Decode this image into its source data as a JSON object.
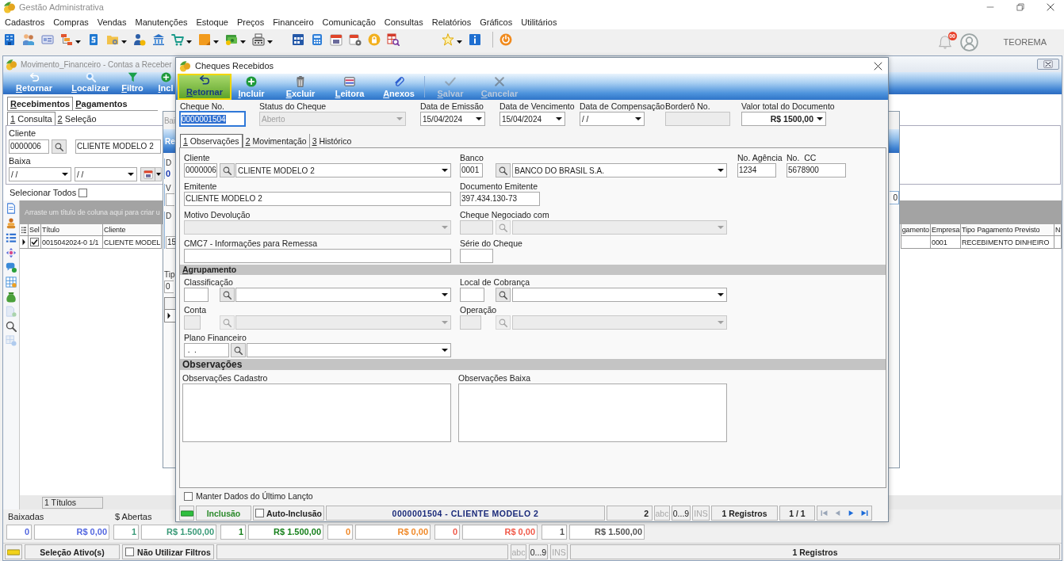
{
  "app_window": {
    "title": "Gestão Administrativa",
    "notification_count": "00",
    "user": "TEOREMA"
  },
  "menu_bar": [
    "Cadastros",
    "Compras",
    "Vendas",
    "Manutenções",
    "Estoque",
    "Preços",
    "Financeiro",
    "Comunicação",
    "Consultas",
    "Relatórios",
    "Gráficos",
    "Utilitários"
  ],
  "toolbar": [
    [
      {
        "dropdown": false
      },
      {
        "dropdown": false
      },
      {
        "dropdown": false
      },
      {
        "dropdown": true
      },
      {
        "dropdown": false
      },
      {
        "dropdown": true
      },
      {
        "dropdown": false
      },
      {
        "dropdown": false
      },
      {
        "dropdown": true
      },
      {
        "dropdown": true
      },
      {
        "dropdown": true
      },
      {
        "dropdown": true
      }
    ],
    [
      {
        "dropdown": false
      },
      {
        "dropdown": false
      },
      {
        "dropdown": false
      },
      {
        "dropdown": false
      },
      {
        "dropdown": false
      },
      {
        "dropdown": false
      }
    ],
    [
      {
        "dropdown": true
      },
      {
        "dropdown": false
      }
    ],
    [
      {
        "dropdown": false
      }
    ]
  ],
  "contas_window": {
    "title": "Movimento_Financeiro - Contas a Receber",
    "toolbar": [
      {
        "label": "Retornar"
      },
      {
        "label": "Localizar"
      },
      {
        "label": "Filtro"
      },
      {
        "label": "Incl"
      }
    ],
    "tabs": [
      {
        "label": "Recebimentos",
        "selected": true
      },
      {
        "label": "Pagamentos",
        "selected": false
      }
    ],
    "subtabs": [
      {
        "label": "1 Consulta",
        "selected": true
      },
      {
        "label": "2 Seleção",
        "selected": false
      }
    ],
    "cliente": {
      "label": "Cliente",
      "code": "0000006",
      "name": "CLIENTE MODELO 2"
    },
    "baixa": {
      "label": "Baixa",
      "from": "/ /",
      "to": "/ /"
    },
    "select_all": {
      "label": "Selecionar Todos",
      "checked": false
    },
    "side_tools": [
      {
        "disabled": false
      },
      {
        "disabled": false
      },
      {
        "disabled": false
      },
      {
        "disabled": false
      },
      {
        "disabled": false
      },
      {
        "disabled": false
      },
      {
        "disabled": false
      },
      {
        "disabled": true
      },
      {
        "disabled": false
      },
      {
        "disabled": true
      }
    ],
    "group_hint": "Arraste um título de coluna aqui para criar u",
    "grid": {
      "columns": [
        "Sel",
        "Título",
        "Cliente"
      ],
      "columns_right": [
        "gamento",
        "Empresa",
        "Tipo Pagamento Previsto",
        "N"
      ],
      "rows": [
        {
          "current": true,
          "checked": true,
          "titulo": "0015042024-0 1/1",
          "cliente": "CLIENTE MODEL",
          "empresa": "0001",
          "tipo_pagamento_previsto": "RECEBIMENTO DINHEIRO"
        }
      ]
    },
    "footer_count": "1 Títulos",
    "totals": {
      "baixadas_label": "Baixadas",
      "abertas_label": "$ Abertas",
      "items": [
        {
          "count": "0",
          "amount": "R$ 0,00",
          "color": "#5468e0"
        },
        {
          "count": "1",
          "amount": "R$ 1.500,00",
          "color": "#3a9a78"
        },
        {
          "count": "1",
          "amount": "R$ 1.500,00",
          "color": "#17801c"
        },
        {
          "count": "0",
          "amount": "R$ 0,00",
          "color": "#f08a2a"
        },
        {
          "count": "0",
          "amount": "R$ 0,00",
          "color": "#f05a4a"
        },
        {
          "count": "1",
          "amount": "R$ 1.500,00",
          "color": "#555555"
        }
      ]
    },
    "status_bar": {
      "selection": "Seleção Ativo(s)",
      "no_filters": {
        "label": "Não Utilizar Filtros",
        "checked": false
      },
      "indicators": [
        {
          "label": "abc",
          "active": false
        },
        {
          "label": "0...9",
          "active": true
        },
        {
          "label": "INS",
          "active": false
        }
      ],
      "records": "1 Registros"
    }
  },
  "middle_window": {
    "title": "Bai",
    "bar_label": "Re",
    "group_1_label": "D",
    "group_1_value": "0",
    "group_2_label": "V",
    "group_3_label": "D",
    "group_3_value": "15",
    "field_label": "Tip",
    "field_value": "0",
    "grid_rows": [
      {
        "current": true
      }
    ],
    "right_value": "0"
  },
  "cheque_dialog": {
    "title": "Cheques Recebidos",
    "toolbar": [
      {
        "label": "Retornar",
        "highlighted": true,
        "disabled": false
      },
      {
        "label": "Incluir",
        "highlighted": false,
        "disabled": false
      },
      {
        "label": "Excluir",
        "highlighted": false,
        "disabled": false
      },
      {
        "label": "Leitora",
        "highlighted": false,
        "disabled": false
      },
      {
        "label": "Anexos",
        "highlighted": false,
        "disabled": false
      },
      {
        "label": "Salvar",
        "highlighted": false,
        "disabled": true
      },
      {
        "label": "Cancelar",
        "highlighted": false,
        "disabled": true
      }
    ],
    "cheque_no": {
      "label": "Cheque No.",
      "value": "0000001504",
      "focused": true
    },
    "status": {
      "label": "Status do Cheque",
      "value": "Aberto",
      "disabled": true
    },
    "data_emissao": {
      "label": "Data de Emissão",
      "value": "15/04/2024"
    },
    "data_vencimento": {
      "label": "Data de Vencimento",
      "value": "15/04/2024"
    },
    "data_compensacao": {
      "label": "Data de Compensação",
      "value": "/ /"
    },
    "bordero": {
      "label": "Borderô No.",
      "disabled": true
    },
    "valor_total": {
      "label": "Valor total do Documento",
      "value": "R$ 1500,00"
    },
    "tabs": [
      {
        "label": "1 Observações",
        "selected": true
      },
      {
        "label": "2 Movimentação",
        "selected": false
      },
      {
        "label": "3 Histórico",
        "selected": false
      }
    ],
    "cliente": {
      "label": "Cliente",
      "code": "0000006",
      "name": "CLIENTE MODELO 2"
    },
    "banco": {
      "label": "Banco",
      "code": "0001",
      "name": "BANCO DO BRASIL S.A."
    },
    "agencia": {
      "label": "No. Agência",
      "value": "1234"
    },
    "conta_corrente": {
      "label": "No.  CC",
      "value": "5678900"
    },
    "emitente": {
      "label": "Emitente",
      "value": "CLIENTE MODELO 2"
    },
    "documento_emitente": {
      "label": "Documento Emitente",
      "value": "397.434.130-73"
    },
    "motivo_devolucao": {
      "label": "Motivo Devolução",
      "disabled": true
    },
    "cheque_negociado": {
      "label": "Cheque Negociado com",
      "disabled": true
    },
    "cmc7": {
      "label": "CMC7 - Informações para Remessa"
    },
    "serie": {
      "label": "Série do Cheque"
    },
    "agrupamento": "Agrupamento",
    "classificacao": {
      "label": "Classificação",
      "disabled": false
    },
    "local_cobranca": {
      "label": "Local de Cobrança",
      "disabled": false
    },
    "conta": {
      "label": "Conta",
      "disabled": true
    },
    "operacao": {
      "label": "Operação",
      "disabled": true
    },
    "plano_financeiro": {
      "label": "Plano Financeiro",
      "value": " .  ."
    },
    "observacoes": {
      "title": "Observações",
      "cadastro_label": "Observações Cadastro",
      "baixa_label": "Observações Baixa"
    },
    "manter_dados": {
      "label": "Manter Dados do Último Lançto",
      "checked": false
    },
    "status_bar": {
      "mode": "Inclusão",
      "auto_inclusao": {
        "label": "Auto-Inclusão",
        "checked": false
      },
      "record": "0000001504 - CLIENTE MODELO 2",
      "field_count": "2",
      "indicators": [
        {
          "label": "abc",
          "active": false
        },
        {
          "label": "0...9",
          "active": true
        },
        {
          "label": "INS",
          "active": false
        }
      ],
      "records": "1 Registros",
      "position": "1 / 1",
      "navigation": [
        {
          "disabled": true
        },
        {
          "disabled": true
        },
        {
          "disabled": false
        },
        {
          "disabled": false
        }
      ]
    }
  }
}
